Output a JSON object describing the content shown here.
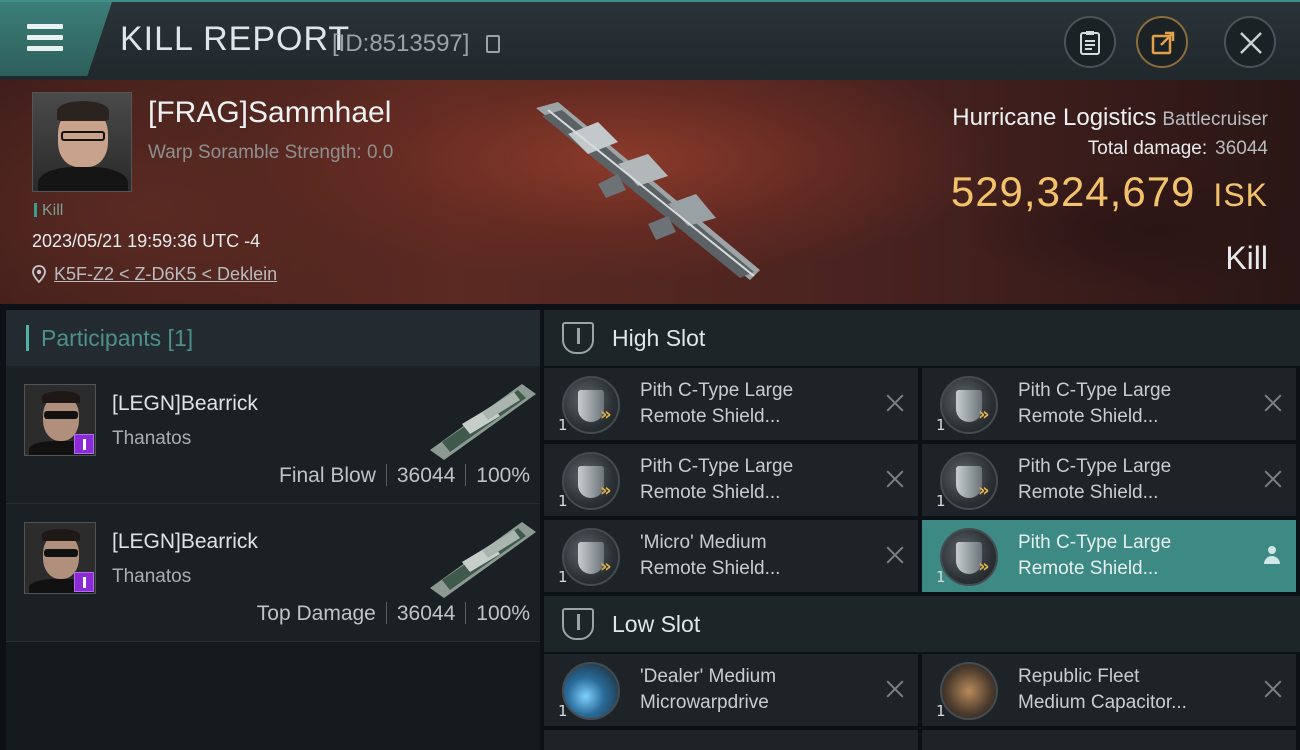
{
  "header": {
    "title": "KILL REPORT",
    "report_id": "[ID:8513597]"
  },
  "victim": {
    "name": "[FRAG]Sammhael",
    "scramble": "Warp Soramble Strength: 0.0",
    "kill_tag": "Kill",
    "datetime": "2023/05/21 19:59:36 UTC -4",
    "location": "K5F-Z2 < Z-D6K5 < Deklein"
  },
  "ship": {
    "name": "Hurricane Logistics",
    "class": "Battlecruiser",
    "total_damage_label": "Total damage:",
    "total_damage": "36044",
    "isk_value": "529,324,679",
    "isk_unit": "ISK",
    "status": "Kill"
  },
  "participants": {
    "header": "Participants [1]",
    "rows": [
      {
        "name": "[LEGN]Bearrick",
        "ship": "Thanatos",
        "role": "Final Blow",
        "damage": "36044",
        "percent": "100%"
      },
      {
        "name": "[LEGN]Bearrick",
        "ship": "Thanatos",
        "role": "Top Damage",
        "damage": "36044",
        "percent": "100%"
      }
    ]
  },
  "fittings": {
    "high_slot_label": "High Slot",
    "low_slot_label": "Low Slot",
    "high": [
      {
        "qty": "1",
        "line1": "Pith C-Type Large",
        "line2": "Remote Shield...",
        "icon": "shield-booster-icon"
      },
      {
        "qty": "1",
        "line1": "Pith C-Type Large",
        "line2": "Remote Shield...",
        "icon": "shield-booster-icon"
      },
      {
        "qty": "1",
        "line1": "Pith C-Type Large",
        "line2": "Remote Shield...",
        "icon": "shield-booster-icon"
      },
      {
        "qty": "1",
        "line1": "Pith C-Type Large",
        "line2": "Remote Shield...",
        "icon": "shield-booster-icon"
      },
      {
        "qty": "1",
        "line1": "'Micro' Medium",
        "line2": "Remote Shield...",
        "icon": "shield-booster-icon"
      },
      {
        "qty": "1",
        "line1": "Pith C-Type Large",
        "line2": "Remote Shield...",
        "icon": "shield-booster-icon"
      }
    ],
    "low": [
      {
        "qty": "1",
        "line1": "'Dealer' Medium",
        "line2": "Microwarpdrive",
        "icon": "microwarpdrive-icon"
      },
      {
        "qty": "1",
        "line1": "Republic Fleet",
        "line2": "Medium Capacitor...",
        "icon": "capacitor-booster-icon"
      }
    ]
  },
  "colors": {
    "accent": "#3d8a84",
    "isk": "#f2c36b",
    "participants_header": "#4d8f8a"
  }
}
